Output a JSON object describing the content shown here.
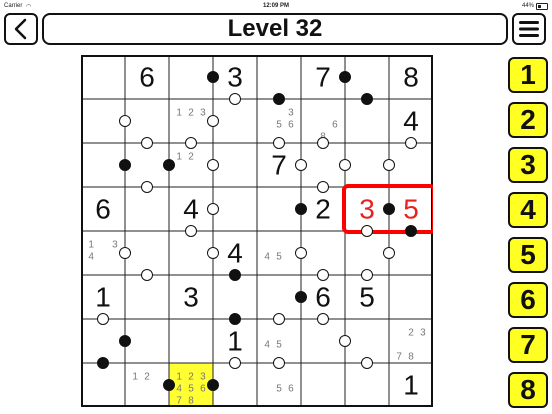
{
  "status_bar": {
    "carrier": "Carrier",
    "time": "12:09 PM",
    "battery": "44%"
  },
  "header": {
    "title": "Level 32"
  },
  "numpad": [
    "1",
    "2",
    "3",
    "4",
    "5",
    "6",
    "7",
    "8"
  ],
  "colors": {
    "highlight_cell": "#ffff33",
    "selection_border": "#ff0000",
    "selected_digit": "#e8231f",
    "numpad_bg": "#ffff22",
    "candidate": "#777777",
    "value": "#111111"
  },
  "board": {
    "size": 8,
    "values": [
      [
        null,
        "6",
        null,
        "3",
        null,
        "7",
        null,
        "8"
      ],
      [
        null,
        null,
        null,
        null,
        null,
        null,
        null,
        "4"
      ],
      [
        null,
        null,
        null,
        null,
        "7",
        null,
        null,
        null
      ],
      [
        "6",
        null,
        "4",
        null,
        null,
        "2",
        "3",
        "5"
      ],
      [
        null,
        null,
        null,
        "4",
        null,
        null,
        null,
        null
      ],
      [
        "1",
        null,
        "3",
        null,
        null,
        "6",
        "5",
        null
      ],
      [
        null,
        null,
        null,
        "1",
        null,
        null,
        null,
        null
      ],
      [
        null,
        null,
        null,
        null,
        null,
        null,
        null,
        "1"
      ]
    ],
    "candidates": [
      {
        "r": 1,
        "c": 2,
        "digits": [
          1,
          2,
          3
        ]
      },
      {
        "r": 1,
        "c": 4,
        "digits": [
          3,
          5,
          6
        ]
      },
      {
        "r": 1,
        "c": 5,
        "digits": [
          6,
          8
        ]
      },
      {
        "r": 2,
        "c": 2,
        "digits": [
          1,
          2
        ]
      },
      {
        "r": 4,
        "c": 0,
        "digits": [
          1,
          3,
          4
        ]
      },
      {
        "r": 4,
        "c": 4,
        "digits": [
          4,
          5
        ]
      },
      {
        "r": 6,
        "c": 4,
        "digits": [
          4,
          5
        ]
      },
      {
        "r": 6,
        "c": 7,
        "digits": [
          2,
          3,
          7,
          8
        ]
      },
      {
        "r": 7,
        "c": 1,
        "digits": [
          1,
          2
        ]
      },
      {
        "r": 7,
        "c": 2,
        "digits": [
          1,
          2,
          3,
          4,
          5,
          6,
          7,
          8
        ]
      },
      {
        "r": 7,
        "c": 4,
        "digits": [
          5,
          6
        ]
      }
    ],
    "highlighted_cell": {
      "r": 7,
      "c": 2
    },
    "selected_cells": [
      {
        "r": 3,
        "c": 6
      },
      {
        "r": 3,
        "c": 7
      }
    ],
    "dots": [
      {
        "r": 0,
        "c": 2,
        "side": "right",
        "color": "black"
      },
      {
        "r": 0,
        "c": 5,
        "side": "right",
        "color": "black"
      },
      {
        "r": 0,
        "c": 3,
        "side": "bottom",
        "color": "white"
      },
      {
        "r": 0,
        "c": 4,
        "side": "bottom",
        "color": "black"
      },
      {
        "r": 0,
        "c": 6,
        "side": "bottom",
        "color": "black"
      },
      {
        "r": 1,
        "c": 0,
        "side": "right",
        "color": "white"
      },
      {
        "r": 1,
        "c": 2,
        "side": "right",
        "color": "white"
      },
      {
        "r": 1,
        "c": 1,
        "side": "bottom",
        "color": "white"
      },
      {
        "r": 1,
        "c": 2,
        "side": "bottom",
        "color": "white"
      },
      {
        "r": 1,
        "c": 4,
        "side": "bottom",
        "color": "white"
      },
      {
        "r": 1,
        "c": 5,
        "side": "bottom",
        "color": "white"
      },
      {
        "r": 1,
        "c": 7,
        "side": "bottom",
        "color": "white"
      },
      {
        "r": 2,
        "c": 0,
        "side": "right",
        "color": "black"
      },
      {
        "r": 2,
        "c": 1,
        "side": "right",
        "color": "black"
      },
      {
        "r": 2,
        "c": 2,
        "side": "right",
        "color": "white"
      },
      {
        "r": 2,
        "c": 4,
        "side": "right",
        "color": "white"
      },
      {
        "r": 2,
        "c": 5,
        "side": "right",
        "color": "white"
      },
      {
        "r": 2,
        "c": 6,
        "side": "right",
        "color": "white"
      },
      {
        "r": 2,
        "c": 1,
        "side": "bottom",
        "color": "white"
      },
      {
        "r": 2,
        "c": 5,
        "side": "bottom",
        "color": "white"
      },
      {
        "r": 3,
        "c": 2,
        "side": "right",
        "color": "white"
      },
      {
        "r": 3,
        "c": 4,
        "side": "right",
        "color": "black"
      },
      {
        "r": 3,
        "c": 6,
        "side": "right",
        "color": "black"
      },
      {
        "r": 3,
        "c": 2,
        "side": "bottom",
        "color": "white"
      },
      {
        "r": 3,
        "c": 6,
        "side": "bottom",
        "color": "white"
      },
      {
        "r": 3,
        "c": 7,
        "side": "bottom",
        "color": "black"
      },
      {
        "r": 4,
        "c": 0,
        "side": "right",
        "color": "white"
      },
      {
        "r": 4,
        "c": 2,
        "side": "right",
        "color": "white"
      },
      {
        "r": 4,
        "c": 4,
        "side": "right",
        "color": "white"
      },
      {
        "r": 4,
        "c": 6,
        "side": "right",
        "color": "white"
      },
      {
        "r": 4,
        "c": 1,
        "side": "bottom",
        "color": "white"
      },
      {
        "r": 4,
        "c": 3,
        "side": "bottom",
        "color": "black"
      },
      {
        "r": 4,
        "c": 5,
        "side": "bottom",
        "color": "white"
      },
      {
        "r": 4,
        "c": 6,
        "side": "bottom",
        "color": "white"
      },
      {
        "r": 5,
        "c": 4,
        "side": "right",
        "color": "black"
      },
      {
        "r": 5,
        "c": 0,
        "side": "bottom",
        "color": "white"
      },
      {
        "r": 5,
        "c": 3,
        "side": "bottom",
        "color": "black"
      },
      {
        "r": 5,
        "c": 4,
        "side": "bottom",
        "color": "white"
      },
      {
        "r": 5,
        "c": 5,
        "side": "bottom",
        "color": "white"
      },
      {
        "r": 6,
        "c": 0,
        "side": "right",
        "color": "black"
      },
      {
        "r": 6,
        "c": 5,
        "side": "right",
        "color": "white"
      },
      {
        "r": 6,
        "c": 3,
        "side": "bottom",
        "color": "white"
      },
      {
        "r": 6,
        "c": 0,
        "side": "bottom",
        "color": "black"
      },
      {
        "r": 6,
        "c": 4,
        "side": "bottom",
        "color": "white"
      },
      {
        "r": 6,
        "c": 6,
        "side": "bottom",
        "color": "white"
      },
      {
        "r": 7,
        "c": 1,
        "side": "right",
        "color": "black"
      },
      {
        "r": 7,
        "c": 2,
        "side": "right",
        "color": "black"
      }
    ]
  },
  "icons": {
    "back": "chevron-left-icon",
    "menu": "hamburger-menu-icon"
  }
}
